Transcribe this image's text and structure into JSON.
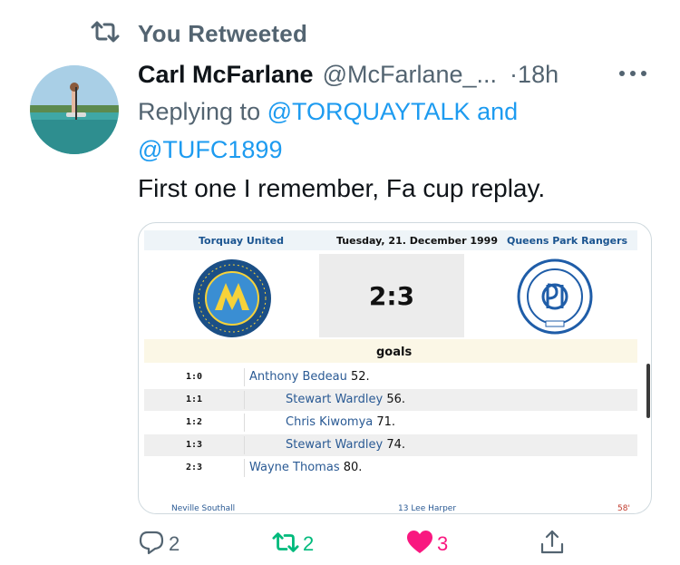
{
  "retweet_banner": {
    "text": "You Retweeted",
    "icon": "retweet-icon"
  },
  "tweet": {
    "author_name": "Carl McFarlane",
    "author_handle": "@McFarlane_...",
    "separator": "·",
    "time": "18h",
    "replying_prefix": "Replying to",
    "replying_to_1": "@TORQUAYTALK",
    "replying_and": "and",
    "replying_to_2": "@TUFC1899",
    "text": "First one I remember, Fa cup replay."
  },
  "match_card": {
    "home_team": "Torquay United",
    "date": "Tuesday, 21. December 1999",
    "away_team": "Queens Park Rangers",
    "score": "2:3",
    "goals_label": "goals",
    "goals": [
      {
        "score": "1:0",
        "scorer": "Anthony Bedeau",
        "minute": "52.",
        "side": "home"
      },
      {
        "score": "1:1",
        "scorer": "Stewart Wardley",
        "minute": "56.",
        "side": "away"
      },
      {
        "score": "1:2",
        "scorer": "Chris Kiwomya",
        "minute": "71.",
        "side": "away"
      },
      {
        "score": "1:3",
        "scorer": "Stewart Wardley",
        "minute": "74.",
        "side": "away"
      },
      {
        "score": "2:3",
        "scorer": "Wayne Thomas",
        "minute": "80.",
        "side": "home"
      }
    ],
    "lineup_fragment_left": "Neville Southall",
    "lineup_fragment_mid": "13  Lee Harper",
    "lineup_fragment_right": "58'"
  },
  "actions": {
    "reply_count": "2",
    "retweet_count": "2",
    "like_count": "3"
  },
  "colors": {
    "accent": "#1d9bf0",
    "retweeted": "#00ba7c",
    "liked": "#f91880",
    "muted": "#536471"
  }
}
